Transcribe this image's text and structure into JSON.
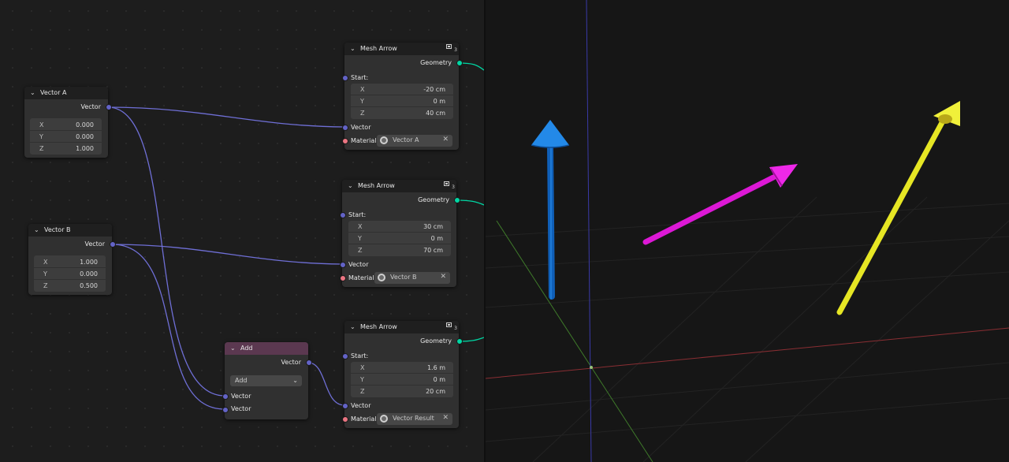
{
  "node_editor": {
    "vector_a": {
      "title": "Vector A",
      "output_label": "Vector",
      "components": [
        {
          "label": "X",
          "value": "0.000"
        },
        {
          "label": "Y",
          "value": "0.000"
        },
        {
          "label": "Z",
          "value": "1.000"
        }
      ]
    },
    "vector_b": {
      "title": "Vector B",
      "output_label": "Vector",
      "components": [
        {
          "label": "X",
          "value": "1.000"
        },
        {
          "label": "Y",
          "value": "0.000"
        },
        {
          "label": "Z",
          "value": "0.500"
        }
      ]
    },
    "add_node": {
      "title": "Add",
      "output_label": "Vector",
      "operation": "Add",
      "input1_label": "Vector",
      "input2_label": "Vector"
    },
    "mesh_arrows": [
      {
        "title": "Mesh Arrow",
        "group_users": "3",
        "output_label": "Geometry",
        "start_label": "Start:",
        "start": [
          {
            "label": "X",
            "value": "-20 cm"
          },
          {
            "label": "Y",
            "value": "0 m"
          },
          {
            "label": "Z",
            "value": "40 cm"
          }
        ],
        "vector_label": "Vector",
        "material_label": "Material:",
        "material": "Vector A"
      },
      {
        "title": "Mesh Arrow",
        "group_users": "3",
        "output_label": "Geometry",
        "start_label": "Start:",
        "start": [
          {
            "label": "X",
            "value": "30 cm"
          },
          {
            "label": "Y",
            "value": "0 m"
          },
          {
            "label": "Z",
            "value": "70 cm"
          }
        ],
        "vector_label": "Vector",
        "material_label": "Material:",
        "material": "Vector B"
      },
      {
        "title": "Mesh Arrow",
        "group_users": "3",
        "output_label": "Geometry",
        "start_label": "Start:",
        "start": [
          {
            "label": "X",
            "value": "1.6 m"
          },
          {
            "label": "Y",
            "value": "0 m"
          },
          {
            "label": "Z",
            "value": "20 cm"
          }
        ],
        "vector_label": "Vector",
        "material_label": "Material:",
        "material": "Vector Result"
      }
    ]
  },
  "viewport_3d": {
    "arrows": [
      {
        "material": "Vector A",
        "color": "#1d7fe0"
      },
      {
        "material": "Vector B",
        "color": "#e81ee0"
      },
      {
        "material": "Vector Result",
        "color": "#ecec1e"
      }
    ],
    "axis_colors": {
      "x": "#8a2e33",
      "y": "#3f7a2a",
      "z": "#3a3aa8"
    }
  },
  "colors": {
    "vector_socket": "#6363c7",
    "geometry_socket": "#00d6a3",
    "material_socket": "#eb7582",
    "link_vector": "#6f6fd6",
    "link_geometry": "#00d6a3",
    "add_header": "#5b3850"
  }
}
